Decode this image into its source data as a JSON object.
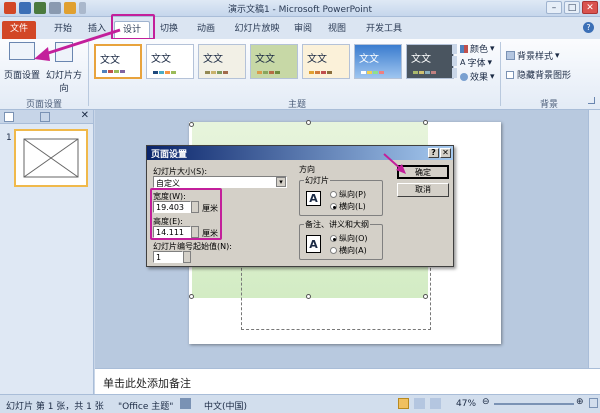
{
  "window": {
    "title": "演示文稿1 - Microsoft PowerPoint"
  },
  "tabs": [
    {
      "label": "文件"
    },
    {
      "label": "开始"
    },
    {
      "label": "插入"
    },
    {
      "label": "设计"
    },
    {
      "label": "切换"
    },
    {
      "label": "动画"
    },
    {
      "label": "幻灯片放映"
    },
    {
      "label": "审阅"
    },
    {
      "label": "视图"
    },
    {
      "label": "开发工具"
    }
  ],
  "ribbon": {
    "page_setup_label": "页面设置",
    "orientation_label": "幻灯片方向",
    "group_page_setup": "页面设置",
    "group_themes": "主题",
    "group_background": "背景",
    "theme_text": "文文",
    "colors_label": "颜色",
    "fonts_label": "字体",
    "effects_label": "效果",
    "bg_styles_label": "背景样式",
    "hide_bg_label": "隐藏背景图形"
  },
  "slide_panel": {
    "slide_number": "1"
  },
  "notes": {
    "placeholder": "单击此处添加备注"
  },
  "dialog": {
    "title": "页面设置",
    "size_label": "幻灯片大小(S):",
    "size_value": "自定义",
    "width_label": "宽度(W):",
    "width_value": "19.403",
    "width_unit": "厘米",
    "height_label": "高度(E):",
    "height_value": "14.111",
    "height_unit": "厘米",
    "numbering_label": "幻灯片编号起始值(N):",
    "numbering_value": "1",
    "orientation_group": "方向",
    "slides_group": "幻灯片",
    "slides_portrait": "纵向(P)",
    "slides_landscape": "横向(L)",
    "notes_group": "备注、讲义和大纲",
    "notes_portrait": "纵向(O)",
    "notes_landscape": "横向(A)",
    "ok_label": "确定",
    "cancel_label": "取消"
  },
  "status": {
    "slide_info": "幻灯片 第 1 张，共 1 张",
    "theme": "\"Office 主题\"",
    "language": "中文(中国)",
    "zoom": "47%"
  },
  "colors": {
    "accent": "#c31f9b",
    "file_tab": "#d24726"
  }
}
